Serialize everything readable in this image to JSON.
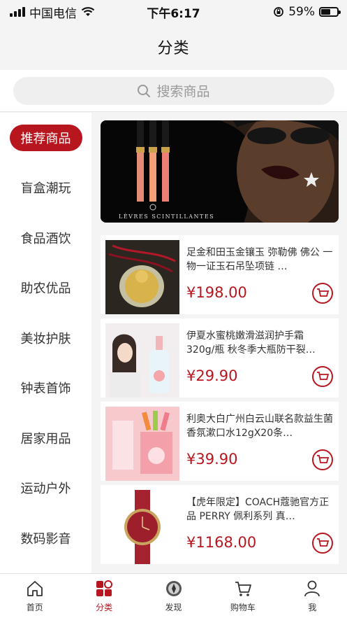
{
  "status_bar": {
    "carrier": "中国电信",
    "time": "下午6:17",
    "battery": "59%"
  },
  "header": {
    "title": "分类"
  },
  "search": {
    "placeholder": "搜索商品"
  },
  "sidebar": {
    "items": [
      {
        "label": "推荐商品",
        "active": true
      },
      {
        "label": "盲盒潮玩"
      },
      {
        "label": "食品酒饮"
      },
      {
        "label": "助农优品"
      },
      {
        "label": "美妆护肤"
      },
      {
        "label": "钟表首饰"
      },
      {
        "label": "居家用品"
      },
      {
        "label": "运动户外"
      },
      {
        "label": "数码影音"
      }
    ]
  },
  "banner": {
    "text": "LÈVRES SCINTILLANTES"
  },
  "products": [
    {
      "name": "足金和田玉金镶玉 弥勒佛 佛公 一物一证玉石吊坠项链 …",
      "price": "¥198.00"
    },
    {
      "name": "伊夏水蜜桃嫩滑滋润护手霜 320g/瓶 秋冬季大瓶防干裂…",
      "price": "¥29.90"
    },
    {
      "name": "利奥大白广州白云山联名款益生菌香氛漱口水12gX20条…",
      "price": "¥39.90"
    },
    {
      "name": "【虎年限定】COACH蔻驰官方正品 PERRY 佩利系列 真…",
      "price": "¥1168.00"
    }
  ],
  "tabbar": {
    "items": [
      {
        "label": "首页",
        "icon": "home-icon"
      },
      {
        "label": "分类",
        "icon": "category-icon",
        "active": true
      },
      {
        "label": "发现",
        "icon": "discover-icon"
      },
      {
        "label": "购物车",
        "icon": "cart-icon"
      },
      {
        "label": "我",
        "icon": "user-icon"
      }
    ]
  },
  "colors": {
    "accent": "#b8161f",
    "background": "#f4f4f4"
  }
}
